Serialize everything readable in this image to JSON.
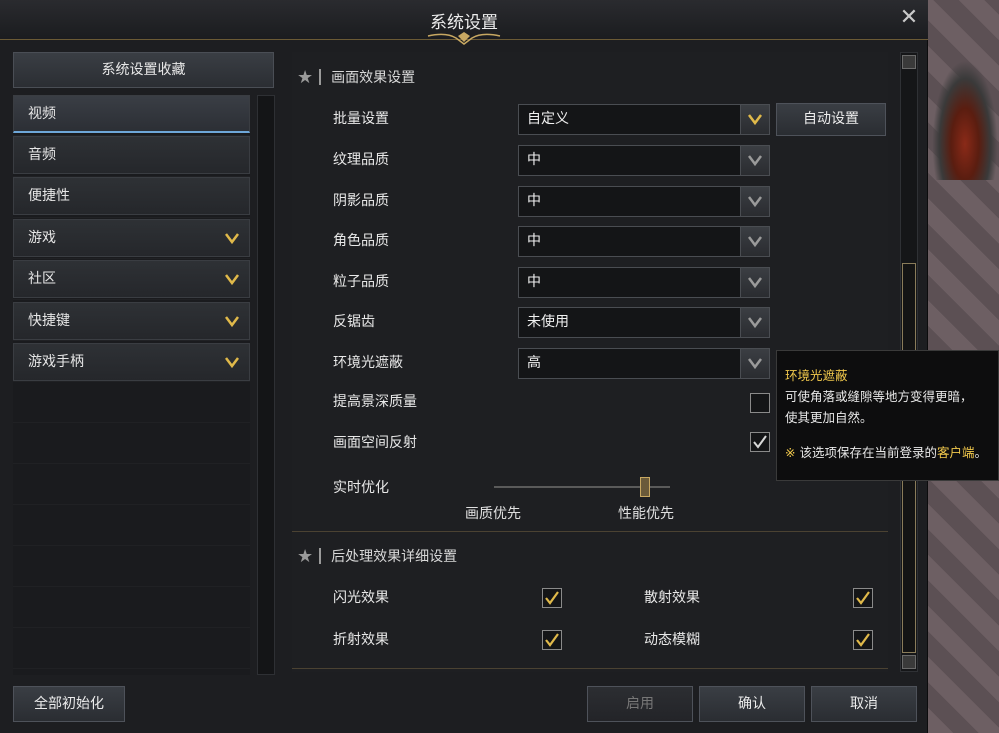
{
  "window": {
    "title": "系统设置"
  },
  "left": {
    "favorites_label": "系统设置收藏",
    "items": [
      {
        "label": "视频",
        "expandable": false,
        "active": true
      },
      {
        "label": "音频",
        "expandable": false
      },
      {
        "label": "便捷性",
        "expandable": false
      },
      {
        "label": "游戏",
        "expandable": true
      },
      {
        "label": "社区",
        "expandable": true
      },
      {
        "label": "快捷键",
        "expandable": true
      },
      {
        "label": "游戏手柄",
        "expandable": true
      }
    ],
    "reset_all_label": "全部初始化"
  },
  "graphics": {
    "section_title": "画面效果设置",
    "batch": {
      "label": "批量设置",
      "value": "自定义",
      "auto_label": "自动设置"
    },
    "texture": {
      "label": "纹理品质",
      "value": "中"
    },
    "shadow": {
      "label": "阴影品质",
      "value": "中"
    },
    "character": {
      "label": "角色品质",
      "value": "中"
    },
    "particle": {
      "label": "粒子品质",
      "value": "中"
    },
    "antialias": {
      "label": "反锯齿",
      "value": "未使用"
    },
    "ao": {
      "label": "环境光遮蔽",
      "value": "高"
    },
    "dof": {
      "label": "提高景深质量",
      "checked": false
    },
    "ssr": {
      "label": "画面空间反射",
      "checked": true
    },
    "realtime": {
      "label": "实时优化",
      "left_caption": "画质优先",
      "right_caption": "性能优先",
      "value_fraction": 0.85
    }
  },
  "post": {
    "section_title": "后处理效果详细设置",
    "bloom": {
      "label": "闪光效果",
      "checked": true
    },
    "scatter": {
      "label": "散射效果",
      "checked": true
    },
    "refraction": {
      "label": "折射效果",
      "checked": true
    },
    "motion_blur": {
      "label": "动态模糊",
      "checked": true
    }
  },
  "tooltip": {
    "title": "环境光遮蔽",
    "line1": "可使角落或缝隙等地方变得更暗，",
    "line2": "使其更加自然。",
    "note_mark": "※",
    "note_text": "该选项保存在当前登录的",
    "note_highlight": "客户端",
    "note_end": "。"
  },
  "footer": {
    "apply_label": "启用",
    "ok_label": "确认",
    "cancel_label": "取消"
  },
  "colors": {
    "accent_gold": "#f2c94c",
    "active_underline": "#6ea7d8",
    "check_gold": "#e0b94a"
  }
}
